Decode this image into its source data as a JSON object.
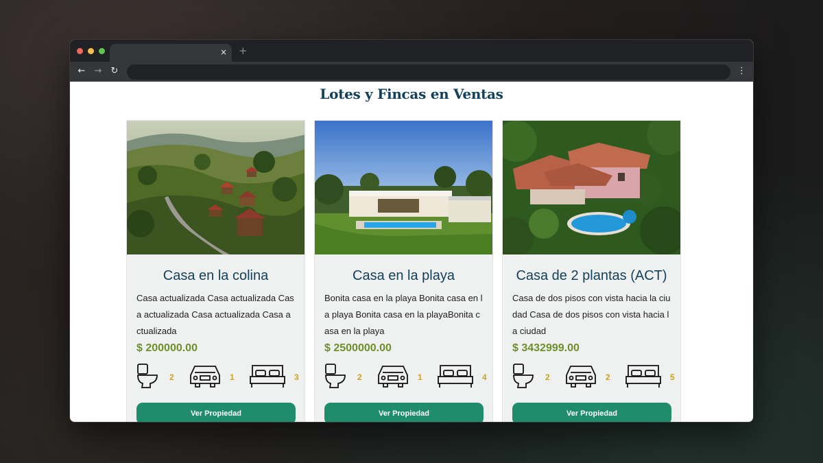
{
  "browser": {
    "tab_close": "×",
    "new_tab": "+",
    "back": "←",
    "forward": "→",
    "reload": "↻",
    "menu": "⋮",
    "colors": {
      "close": "#ec6a5e",
      "minimize": "#f4bf4f",
      "maximize": "#61c554"
    }
  },
  "page": {
    "title": "Lotes y Fincas en Ventas"
  },
  "cards": [
    {
      "title": "Casa en la colina",
      "description": "Casa actualizada Casa actualizada Casa actualizada Casa actualizada Casa actualizada",
      "price": "$ 200000.00",
      "bathrooms": "2",
      "garages": "1",
      "bedrooms": "3",
      "button": "Ver Propiedad"
    },
    {
      "title": "Casa en la playa",
      "description": "Bonita casa en la playa Bonita casa en la playa Bonita casa en la playaBonita casa en la playa",
      "price": "$ 2500000.00",
      "bathrooms": "2",
      "garages": "1",
      "bedrooms": "4",
      "button": "Ver Propiedad"
    },
    {
      "title": "Casa de 2 plantas (ACT)",
      "description": "Casa de dos pisos con vista hacia la ciudad Casa de dos pisos con vista hacia la ciudad",
      "price": "$ 3432999.00",
      "bathrooms": "2",
      "garages": "2",
      "bedrooms": "5",
      "button": "Ver Propiedad"
    }
  ]
}
